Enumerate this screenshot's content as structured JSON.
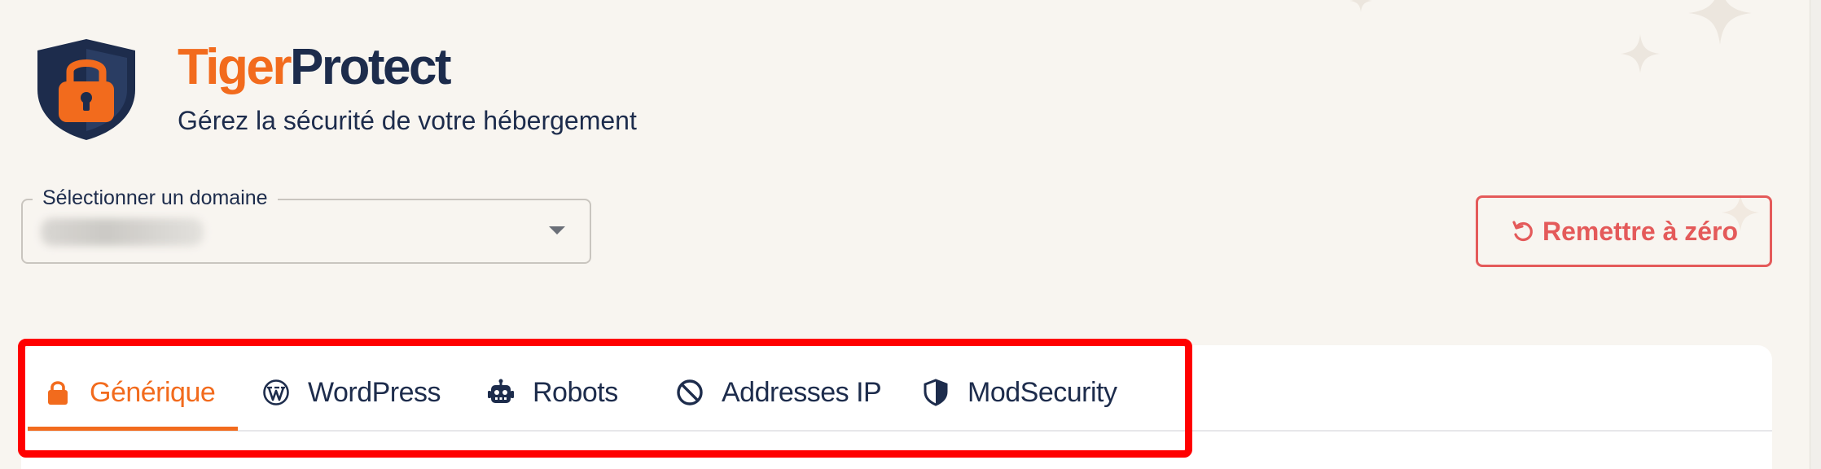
{
  "brand": {
    "name_part1": "Tiger",
    "name_part2": "Protect",
    "subtitle": "Gérez la sécurité de votre hébergement"
  },
  "domain_select": {
    "label": "Sélectionner un domaine",
    "value_redacted": true
  },
  "reset_button": {
    "label": "Remettre à zéro",
    "icon": "reset-icon"
  },
  "tabs": [
    {
      "label": "Générique",
      "icon": "lock-icon",
      "active": true
    },
    {
      "label": "WordPress",
      "icon": "wordpress-icon",
      "active": false
    },
    {
      "label": "Robots",
      "icon": "robot-icon",
      "active": false
    },
    {
      "label": "Addresses IP",
      "icon": "ban-icon",
      "active": false
    },
    {
      "label": "ModSecurity",
      "icon": "shield-half-icon",
      "active": false
    }
  ],
  "colors": {
    "accent": "#f26b1d",
    "navy": "#1d2c4c",
    "danger": "#e45a5a",
    "background": "#f8f5f0",
    "highlight": "#ff0000"
  }
}
